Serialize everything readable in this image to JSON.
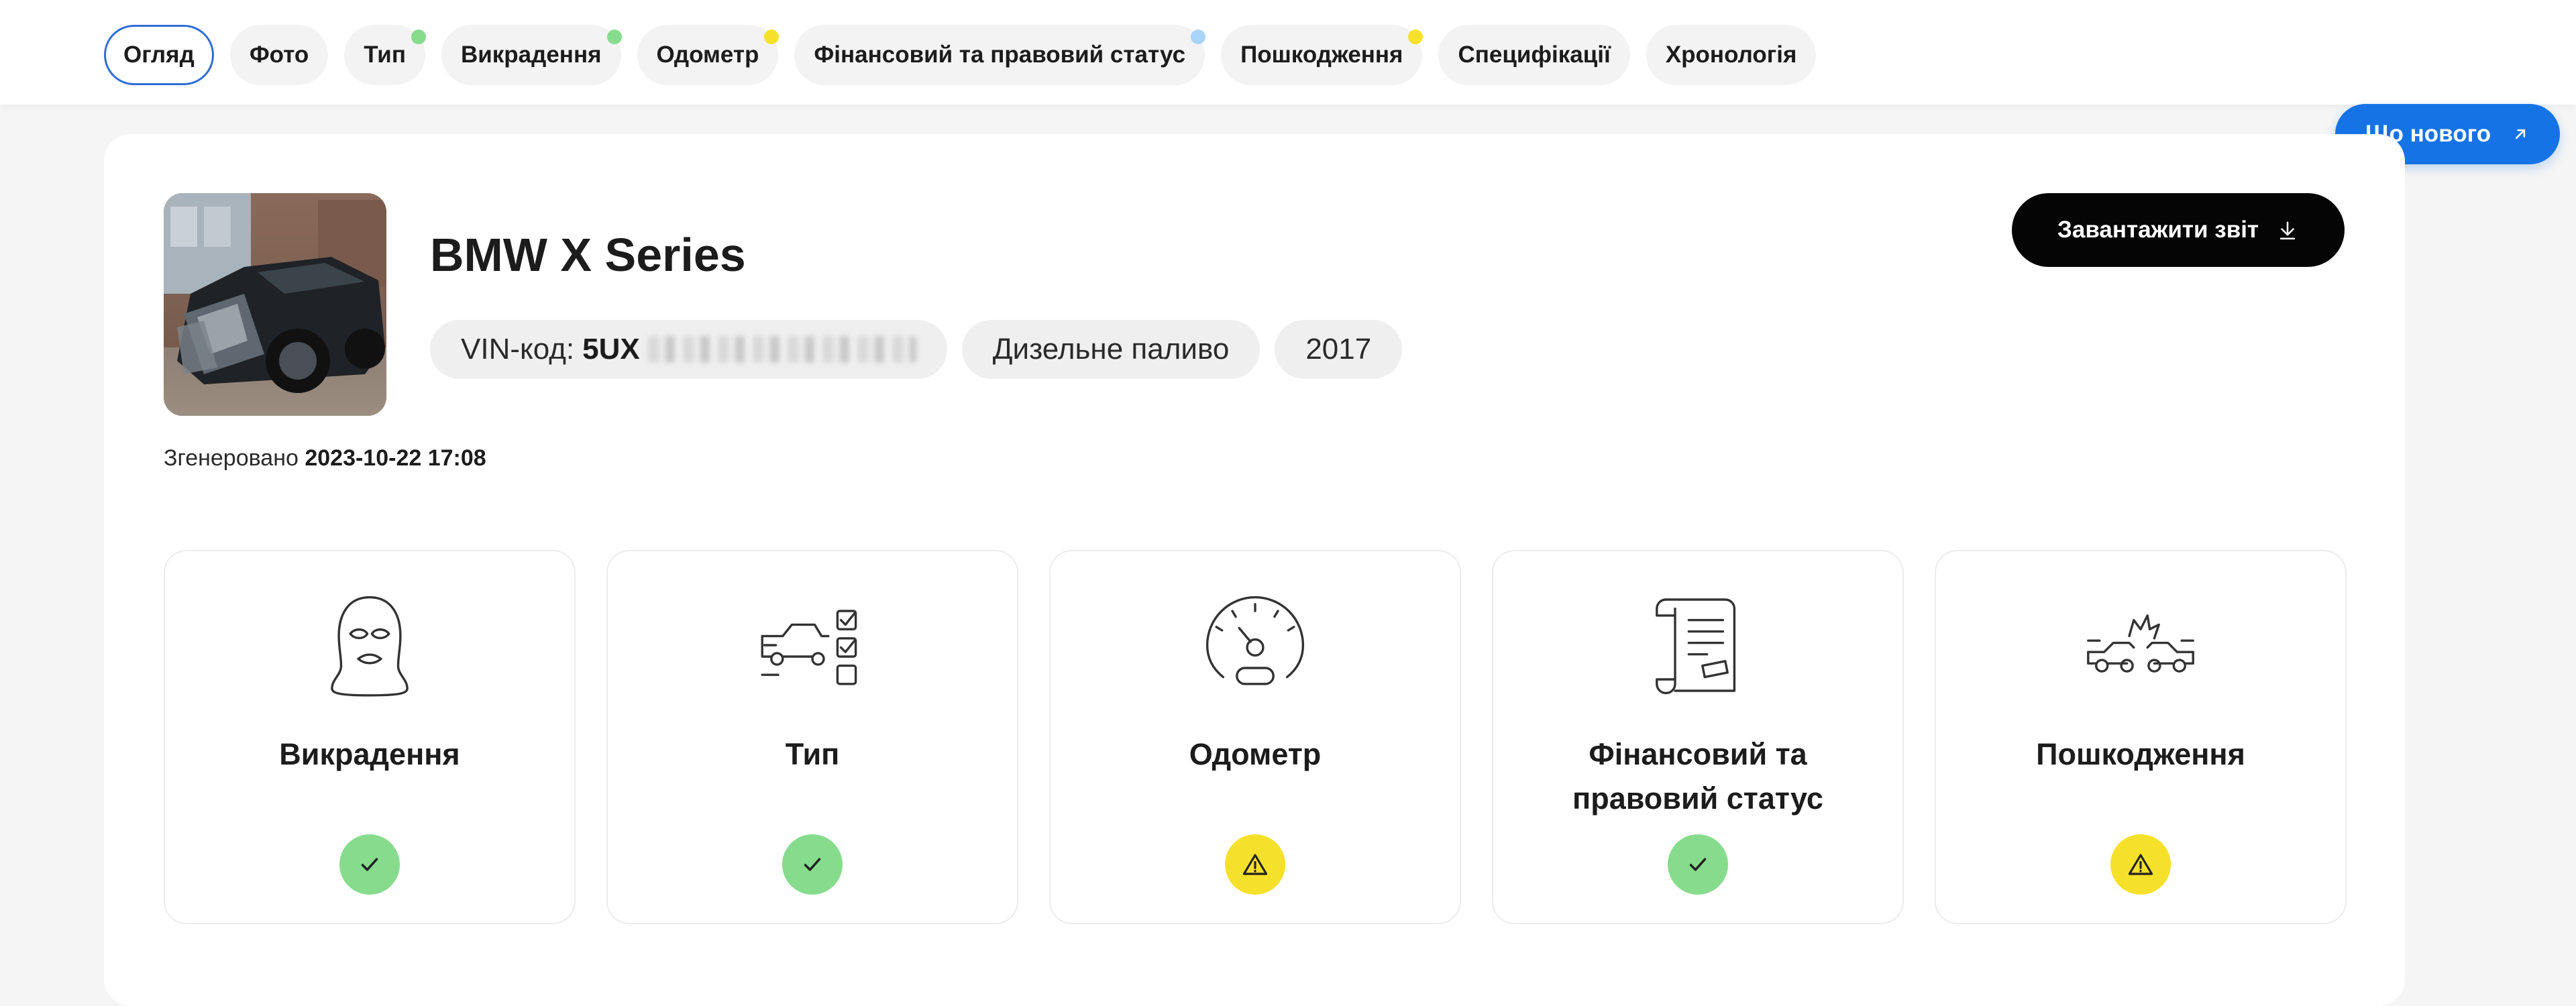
{
  "tabs": [
    {
      "label": "Огляд",
      "active": true,
      "dot": null
    },
    {
      "label": "Фото",
      "active": false,
      "dot": null
    },
    {
      "label": "Тип",
      "active": false,
      "dot": "#86dc8c"
    },
    {
      "label": "Викрадення",
      "active": false,
      "dot": "#86dc8c"
    },
    {
      "label": "Одометр",
      "active": false,
      "dot": "#f6e12a"
    },
    {
      "label": "Фінансовий та правовий статус",
      "active": false,
      "dot": "#a8d4f8"
    },
    {
      "label": "Пошкодження",
      "active": false,
      "dot": "#f6e12a"
    },
    {
      "label": "Специфікації",
      "active": false,
      "dot": null
    },
    {
      "label": "Хронологія",
      "active": false,
      "dot": null
    }
  ],
  "whats_new": {
    "label": "Що нового",
    "icon": "arrow-up-right-icon"
  },
  "vehicle": {
    "title": "BMW X Series",
    "vin_label": "VIN-код:",
    "vin_visible": "5UX",
    "fuel": "Дизельне паливо",
    "year": "2017"
  },
  "download": {
    "label": "Завантажити звіт",
    "icon": "download-icon"
  },
  "generated": {
    "label": "Згенеровано",
    "value": "2023-10-22 17:08"
  },
  "status_cards": [
    {
      "label": "Викрадення",
      "icon": "balaclava-icon",
      "status": "ok"
    },
    {
      "label": "Тип",
      "icon": "car-checklist-icon",
      "status": "ok"
    },
    {
      "label": "Одометр",
      "icon": "odometer-icon",
      "status": "warning"
    },
    {
      "label": "Фінансовий та правовий статус",
      "icon": "document-scroll-icon",
      "status": "ok"
    },
    {
      "label": "Пошкодження",
      "icon": "car-crash-icon",
      "status": "warning"
    }
  ],
  "colors": {
    "accent": "#1673e6",
    "active_tab_border": "#2f6fd6",
    "ok": "#86dc8c",
    "warning": "#f6e12a",
    "info": "#a8d4f8",
    "button_dark": "#050505"
  }
}
